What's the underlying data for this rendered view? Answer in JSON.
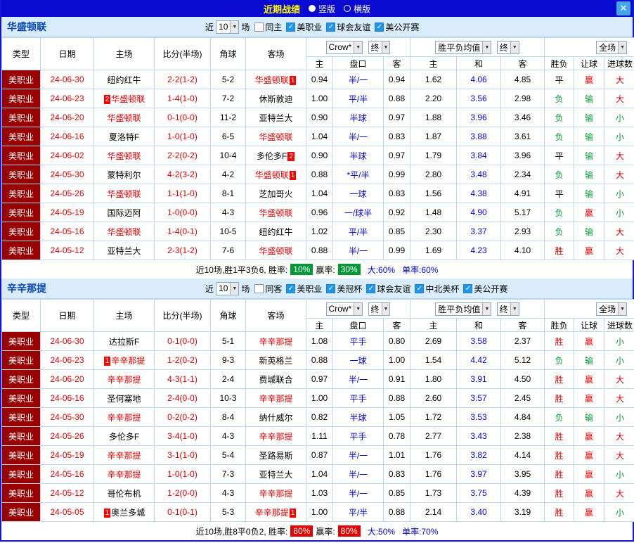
{
  "titlebar": {
    "title": "近期战绩",
    "radio_vertical": "竖版",
    "radio_horizontal": "横版",
    "close": "✕"
  },
  "sections": [
    {
      "team": "华盛顿联",
      "filters": {
        "near_label": "近",
        "count": "10",
        "games_label": "场",
        "checkboxes": [
          {
            "label": "同主",
            "checked": false
          },
          {
            "label": "美职业",
            "checked": true
          },
          {
            "label": "球会友谊",
            "checked": true
          },
          {
            "label": "美公开赛",
            "checked": true
          }
        ]
      },
      "header": {
        "col_type": "类型",
        "col_date": "日期",
        "col_home": "主场",
        "col_score": "比分(半场)",
        "col_corner": "角球",
        "col_away": "客场",
        "odds_select": "Crow*",
        "odds_final": "终",
        "europe_select": "胜平负均值",
        "europe_final": "终",
        "fullmatch_select": "全场",
        "sub": [
          "主",
          "盘口",
          "客",
          "主",
          "和",
          "客",
          "胜负",
          "让球",
          "进球数"
        ]
      },
      "rows": [
        {
          "type": "美职业",
          "date": "24-06-30",
          "home": {
            "name": "纽约红牛"
          },
          "score": "2-2(1-2)",
          "corner": "5-2",
          "away": {
            "name": "华盛顿联",
            "highlight": true,
            "badge": "1",
            "badge_pos": "after"
          },
          "odds": [
            "0.94",
            "半/一",
            "0.94"
          ],
          "europe": [
            "1.62",
            "4.06",
            "4.85"
          ],
          "result": "平",
          "handicap": "赢",
          "goals": "大"
        },
        {
          "type": "美职业",
          "date": "24-06-23",
          "home": {
            "name": "华盛顿联",
            "highlight": true,
            "badge": "2",
            "badge_pos": "before"
          },
          "score": "1-4(1-0)",
          "corner": "7-2",
          "away": {
            "name": "休斯敦迪"
          },
          "odds": [
            "1.00",
            "平/半",
            "0.88"
          ],
          "europe": [
            "2.20",
            "3.56",
            "2.98"
          ],
          "result": "负",
          "handicap": "输",
          "goals": "大"
        },
        {
          "type": "美职业",
          "date": "24-06-20",
          "home": {
            "name": "华盛顿联",
            "highlight": true
          },
          "score": "0-1(0-0)",
          "corner": "11-2",
          "away": {
            "name": "亚特兰大"
          },
          "odds": [
            "0.90",
            "半球",
            "0.97"
          ],
          "europe": [
            "1.88",
            "3.96",
            "3.46"
          ],
          "result": "负",
          "handicap": "输",
          "goals": "小"
        },
        {
          "type": "美职业",
          "date": "24-06-16",
          "home": {
            "name": "夏洛特F"
          },
          "score": "1-0(1-0)",
          "corner": "6-5",
          "away": {
            "name": "华盛顿联",
            "highlight": true
          },
          "odds": [
            "1.04",
            "半/一",
            "0.83"
          ],
          "europe": [
            "1.87",
            "3.88",
            "3.61"
          ],
          "result": "负",
          "handicap": "输",
          "goals": "小"
        },
        {
          "type": "美职业",
          "date": "24-06-02",
          "home": {
            "name": "华盛顿联",
            "highlight": true
          },
          "score": "2-2(0-2)",
          "corner": "10-4",
          "away": {
            "name": "多伦多F",
            "badge": "2",
            "badge_pos": "after"
          },
          "odds": [
            "0.90",
            "半球",
            "0.97"
          ],
          "europe": [
            "1.79",
            "3.84",
            "3.96"
          ],
          "result": "平",
          "handicap": "输",
          "goals": "大"
        },
        {
          "type": "美职业",
          "date": "24-05-30",
          "home": {
            "name": "蒙特利尔"
          },
          "score": "4-2(3-2)",
          "corner": "4-2",
          "away": {
            "name": "华盛顿联",
            "highlight": true,
            "badge": "1",
            "badge_pos": "after"
          },
          "odds": [
            "0.88",
            "*平/半",
            "0.99"
          ],
          "europe": [
            "2.80",
            "3.48",
            "2.34"
          ],
          "result": "负",
          "handicap": "输",
          "goals": "大"
        },
        {
          "type": "美职业",
          "date": "24-05-26",
          "home": {
            "name": "华盛顿联",
            "highlight": true
          },
          "score": "1-1(1-0)",
          "corner": "8-1",
          "away": {
            "name": "芝加哥火"
          },
          "odds": [
            "1.04",
            "一球",
            "0.83"
          ],
          "europe": [
            "1.56",
            "4.38",
            "4.91"
          ],
          "result": "平",
          "handicap": "输",
          "goals": "小"
        },
        {
          "type": "美职业",
          "date": "24-05-19",
          "home": {
            "name": "国际迈阿"
          },
          "score": "1-0(0-0)",
          "corner": "4-3",
          "away": {
            "name": "华盛顿联",
            "highlight": true
          },
          "odds": [
            "0.96",
            "一/球半",
            "0.92"
          ],
          "europe": [
            "1.48",
            "4.90",
            "5.17"
          ],
          "result": "负",
          "handicap": "赢",
          "goals": "小"
        },
        {
          "type": "美职业",
          "date": "24-05-16",
          "home": {
            "name": "华盛顿联",
            "highlight": true
          },
          "score": "1-4(0-1)",
          "corner": "10-5",
          "away": {
            "name": "纽约红牛"
          },
          "odds": [
            "1.02",
            "平/半",
            "0.85"
          ],
          "europe": [
            "2.30",
            "3.37",
            "2.93"
          ],
          "result": "负",
          "handicap": "输",
          "goals": "大"
        },
        {
          "type": "美职业",
          "date": "24-05-12",
          "home": {
            "name": "亚特兰大"
          },
          "score": "2-3(1-2)",
          "corner": "7-6",
          "away": {
            "name": "华盛顿联",
            "highlight": true
          },
          "odds": [
            "0.88",
            "半/一",
            "0.99"
          ],
          "europe": [
            "1.69",
            "4.23",
            "4.10"
          ],
          "result": "胜",
          "handicap": "赢",
          "goals": "大"
        }
      ],
      "footer": {
        "summary": "近10场,胜1平3负6, 胜率:",
        "win_rate": "10%",
        "profit_label": "赢率:",
        "profit_rate": "30%",
        "big_rate": "大:60%",
        "single_rate": "单率:60%",
        "rate_color": "#009933"
      }
    },
    {
      "team": "辛辛那提",
      "filters": {
        "near_label": "近",
        "count": "10",
        "games_label": "场",
        "checkboxes": [
          {
            "label": "同客",
            "checked": false
          },
          {
            "label": "美职业",
            "checked": true
          },
          {
            "label": "美冠杯",
            "checked": true
          },
          {
            "label": "球会友谊",
            "checked": true
          },
          {
            "label": "中北美杯",
            "checked": true
          },
          {
            "label": "美公开赛",
            "checked": true
          }
        ]
      },
      "header": {
        "col_type": "类型",
        "col_date": "日期",
        "col_home": "主场",
        "col_score": "比分(半场)",
        "col_corner": "角球",
        "col_away": "客场",
        "odds_select": "Crow*",
        "odds_final": "终",
        "europe_select": "胜平负均值",
        "europe_final": "终",
        "fullmatch_select": "全场",
        "sub": [
          "主",
          "盘口",
          "客",
          "主",
          "和",
          "客",
          "胜负",
          "让球",
          "进球数"
        ]
      },
      "rows": [
        {
          "type": "美职业",
          "date": "24-06-30",
          "home": {
            "name": "达拉斯F"
          },
          "score": "0-1(0-0)",
          "corner": "5-1",
          "away": {
            "name": "辛辛那提",
            "highlight": true
          },
          "odds": [
            "1.08",
            "平手",
            "0.80"
          ],
          "europe": [
            "2.69",
            "3.58",
            "2.37"
          ],
          "result": "胜",
          "handicap": "赢",
          "goals": "小"
        },
        {
          "type": "美职业",
          "date": "24-06-23",
          "home": {
            "name": "辛辛那提",
            "highlight": true,
            "badge": "1",
            "badge_pos": "before"
          },
          "score": "1-2(0-2)",
          "corner": "9-3",
          "away": {
            "name": "新英格兰"
          },
          "odds": [
            "0.88",
            "一球",
            "1.00"
          ],
          "europe": [
            "1.54",
            "4.42",
            "5.12"
          ],
          "result": "负",
          "handicap": "输",
          "goals": "小"
        },
        {
          "type": "美职业",
          "date": "24-06-20",
          "home": {
            "name": "辛辛那提",
            "highlight": true
          },
          "score": "4-3(1-1)",
          "corner": "2-4",
          "away": {
            "name": "费城联合"
          },
          "odds": [
            "0.97",
            "半/一",
            "0.91"
          ],
          "europe": [
            "1.80",
            "3.91",
            "4.50"
          ],
          "result": "胜",
          "handicap": "赢",
          "goals": "大"
        },
        {
          "type": "美职业",
          "date": "24-06-16",
          "home": {
            "name": "圣何塞地"
          },
          "score": "2-4(0-0)",
          "corner": "10-3",
          "away": {
            "name": "辛辛那提",
            "highlight": true
          },
          "odds": [
            "1.00",
            "平手",
            "0.88"
          ],
          "europe": [
            "2.60",
            "3.57",
            "2.45"
          ],
          "result": "胜",
          "handicap": "赢",
          "goals": "大"
        },
        {
          "type": "美职业",
          "date": "24-05-30",
          "home": {
            "name": "辛辛那提",
            "highlight": true
          },
          "score": "0-2(0-2)",
          "corner": "8-4",
          "away": {
            "name": "纳什威尔"
          },
          "odds": [
            "0.82",
            "半球",
            "1.05"
          ],
          "europe": [
            "1.72",
            "3.53",
            "4.84"
          ],
          "result": "负",
          "handicap": "输",
          "goals": "小"
        },
        {
          "type": "美职业",
          "date": "24-05-26",
          "home": {
            "name": "多伦多F"
          },
          "score": "3-4(1-0)",
          "corner": "4-3",
          "away": {
            "name": "辛辛那提",
            "highlight": true
          },
          "odds": [
            "1.11",
            "平手",
            "0.78"
          ],
          "europe": [
            "2.77",
            "3.43",
            "2.38"
          ],
          "result": "胜",
          "handicap": "赢",
          "goals": "大"
        },
        {
          "type": "美职业",
          "date": "24-05-19",
          "home": {
            "name": "辛辛那提",
            "highlight": true
          },
          "score": "3-1(1-0)",
          "corner": "5-4",
          "away": {
            "name": "圣路易斯"
          },
          "odds": [
            "0.87",
            "半/一",
            "1.01"
          ],
          "europe": [
            "1.76",
            "3.82",
            "4.14"
          ],
          "result": "胜",
          "handicap": "赢",
          "goals": "大"
        },
        {
          "type": "美职业",
          "date": "24-05-16",
          "home": {
            "name": "辛辛那提",
            "highlight": true
          },
          "score": "1-0(1-0)",
          "corner": "7-3",
          "away": {
            "name": "亚特兰大"
          },
          "odds": [
            "1.04",
            "半/一",
            "0.83"
          ],
          "europe": [
            "1.76",
            "3.97",
            "3.95"
          ],
          "result": "胜",
          "handicap": "赢",
          "goals": "小"
        },
        {
          "type": "美职业",
          "date": "24-05-12",
          "home": {
            "name": "哥伦布机"
          },
          "score": "1-2(0-0)",
          "corner": "4-3",
          "away": {
            "name": "辛辛那提",
            "highlight": true
          },
          "odds": [
            "1.03",
            "半/一",
            "0.85"
          ],
          "europe": [
            "1.73",
            "3.75",
            "4.39"
          ],
          "result": "胜",
          "handicap": "赢",
          "goals": "大"
        },
        {
          "type": "美职业",
          "date": "24-05-05",
          "home": {
            "name": "奥兰多城",
            "badge": "1",
            "badge_pos": "before"
          },
          "score": "0-1(0-1)",
          "corner": "5-3",
          "away": {
            "name": "辛辛那提",
            "highlight": true,
            "badge": "1",
            "badge_pos": "after"
          },
          "odds": [
            "1.00",
            "平/半",
            "0.88"
          ],
          "europe": [
            "2.14",
            "3.40",
            "3.19"
          ],
          "result": "胜",
          "handicap": "赢",
          "goals": "小"
        }
      ],
      "footer": {
        "summary": "近10场,胜8平0负2, 胜率:",
        "win_rate": "80%",
        "profit_label": "赢率:",
        "profit_rate": "80%",
        "big_rate": "大:50%",
        "single_rate": "单率:70%",
        "rate_color": "#e60000"
      }
    }
  ]
}
